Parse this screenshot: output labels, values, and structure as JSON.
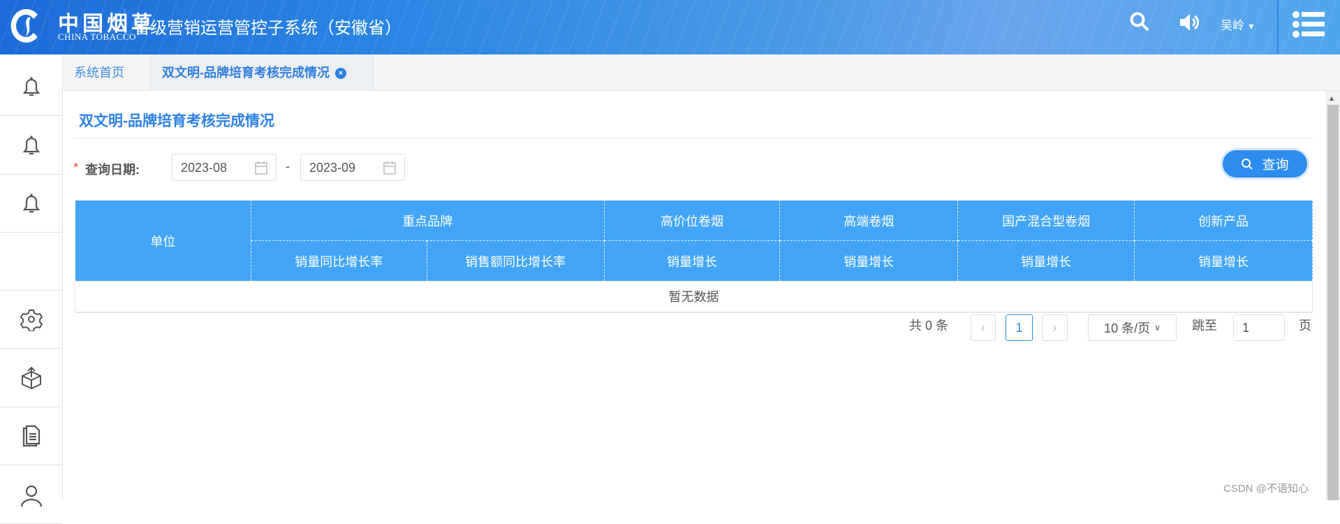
{
  "header": {
    "logo_cn": "中国烟草",
    "logo_en": "CHINA TOBACCO",
    "system_title": "省级营销运营管控子系统（安徽省）",
    "user_name": "吴岭",
    "icons": [
      "search-icon",
      "volume-icon",
      "caret-down-icon",
      "list-menu-icon"
    ]
  },
  "tabs": [
    {
      "label": "系统首页",
      "active": false
    },
    {
      "label": "双文明-品牌培育考核完成情况",
      "active": true,
      "close": "×"
    }
  ],
  "sidebar": {
    "icons": [
      "bell-icon",
      "bell-icon",
      "bell-icon",
      "gear-icon",
      "box-upload-icon",
      "documents-icon",
      "user-icon"
    ]
  },
  "page": {
    "title": "双文明-品牌培育考核完成情况"
  },
  "filter": {
    "required_mark": "*",
    "label": "查询日期:",
    "start": "2023-08",
    "separator": "-",
    "end": "2023-09",
    "query_label": "查询"
  },
  "table": {
    "unit_header": "单位",
    "groups": [
      "重点品牌",
      "高价位卷烟",
      "高端卷烟",
      "国产混合型卷烟",
      "创新产品"
    ],
    "sub_headers": [
      "销量同比增长率",
      "销售额同比增长率",
      "销量增长",
      "销量增长",
      "销量增长",
      "销量增长"
    ],
    "empty_text": "暂无数据"
  },
  "pagination": {
    "total": "共 0 条",
    "current_page": "1",
    "page_size": "10 条/页",
    "jump_label": "跳至",
    "jump_value": "1",
    "page_suffix": "页"
  },
  "watermark": "CSDN @不语知心",
  "colors": {
    "header_blue": "#1d6bd8",
    "accent": "#2d8cf0",
    "table_header": "#42a5f8",
    "required": "#f04134"
  }
}
